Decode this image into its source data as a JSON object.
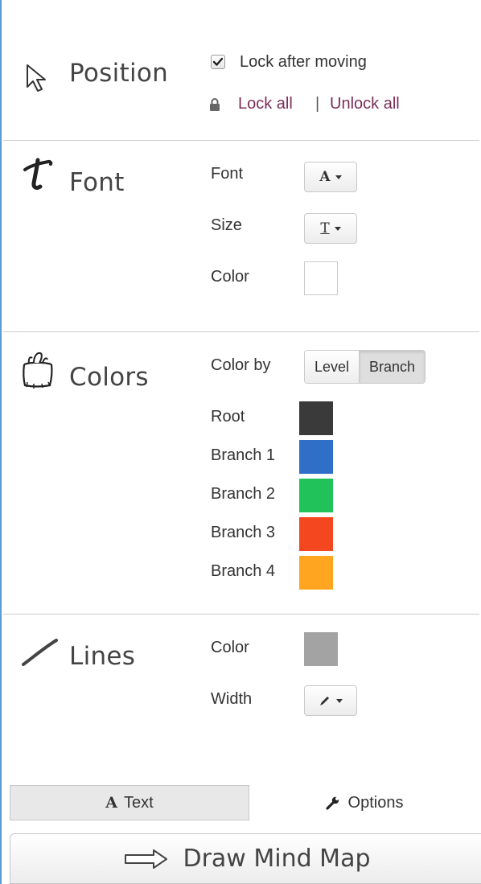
{
  "position": {
    "title": "Position",
    "lock_after_moving_label": "Lock after moving",
    "lock_after_moving_checked": true,
    "lock_all": "Lock all",
    "separator": "|",
    "unlock_all": "Unlock all"
  },
  "font": {
    "title": "Font",
    "font_label": "Font",
    "font_button_glyph": "A",
    "size_label": "Size",
    "size_button_glyph": "T",
    "color_label": "Color",
    "color_value": "#ffffff"
  },
  "colors": {
    "title": "Colors",
    "color_by_label": "Color by",
    "color_by_options": [
      "Level",
      "Branch"
    ],
    "color_by_selected": "Branch",
    "rows": [
      {
        "label": "Root",
        "color": "#3a3a3a"
      },
      {
        "label": "Branch 1",
        "color": "#2f6fc8"
      },
      {
        "label": "Branch 2",
        "color": "#22c25a"
      },
      {
        "label": "Branch 3",
        "color": "#f4471f"
      },
      {
        "label": "Branch 4",
        "color": "#ffa51f"
      }
    ]
  },
  "lines": {
    "title": "Lines",
    "color_label": "Color",
    "color_value": "#a3a3a3",
    "width_label": "Width"
  },
  "tabs": {
    "text_icon": "A",
    "text_label": "Text",
    "options_label": "Options",
    "active": "Text"
  },
  "draw_button": {
    "label": "Draw Mind Map"
  }
}
